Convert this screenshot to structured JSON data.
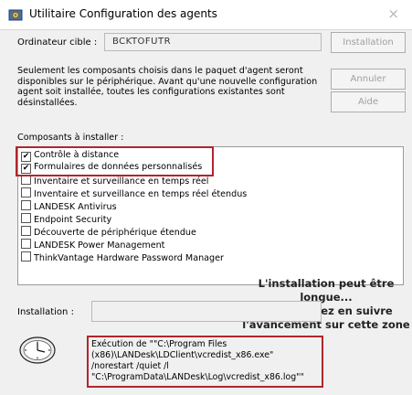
{
  "window": {
    "title": "Utilitaire Configuration des agents",
    "close_glyph": "×",
    "app_icon": "gear-icon"
  },
  "target": {
    "label": "Ordinateur cible :",
    "value": "BCKTOFUTR"
  },
  "buttons": {
    "install": "Installation",
    "cancel": "Annuler",
    "help": "Aide"
  },
  "description": [
    "Seulement les composants choisis dans le paquet d'agent seront",
    "disponibles sur le périphérique. Avant qu'une nouvelle configuration",
    "agent soit installée, toutes les configurations existantes sont",
    "désinstallées."
  ],
  "components": {
    "label": "Composants à installer :",
    "items": [
      {
        "label": "Contrôle à distance",
        "checked": true
      },
      {
        "label": "Formulaires de données personnalisés",
        "checked": true
      },
      {
        "label": "Inventaire et surveillance en temps réel",
        "checked": false
      },
      {
        "label": "Inventaire et surveillance en temps réel étendus",
        "checked": false
      },
      {
        "label": "LANDESK Antivirus",
        "checked": false
      },
      {
        "label": "Endpoint Security",
        "checked": false
      },
      {
        "label": "Découverte de périphérique étendue",
        "checked": false
      },
      {
        "label": "LANDESK Power Management",
        "checked": false
      },
      {
        "label": "ThinkVantage Hardware Password Manager",
        "checked": false
      }
    ]
  },
  "annotation": [
    "L'installation peut être",
    "longue...",
    "Vous pouvez en suivre",
    "l'avancement sur cette zone"
  ],
  "installation": {
    "label": "Installation :",
    "status_lines": [
      "Exécution de \"\"C:\\Program Files",
      "(x86)\\LANDesk\\LDClient\\vcredist_x86.exe\"",
      "/norestart /quiet /l",
      "\"C:\\ProgramData\\LANDesk\\Log\\vcredist_x86.log\"\""
    ],
    "progress_icon": "clock-icon"
  },
  "colors": {
    "highlight": "#b0262c",
    "disabled_text": "#a0a0a0"
  }
}
